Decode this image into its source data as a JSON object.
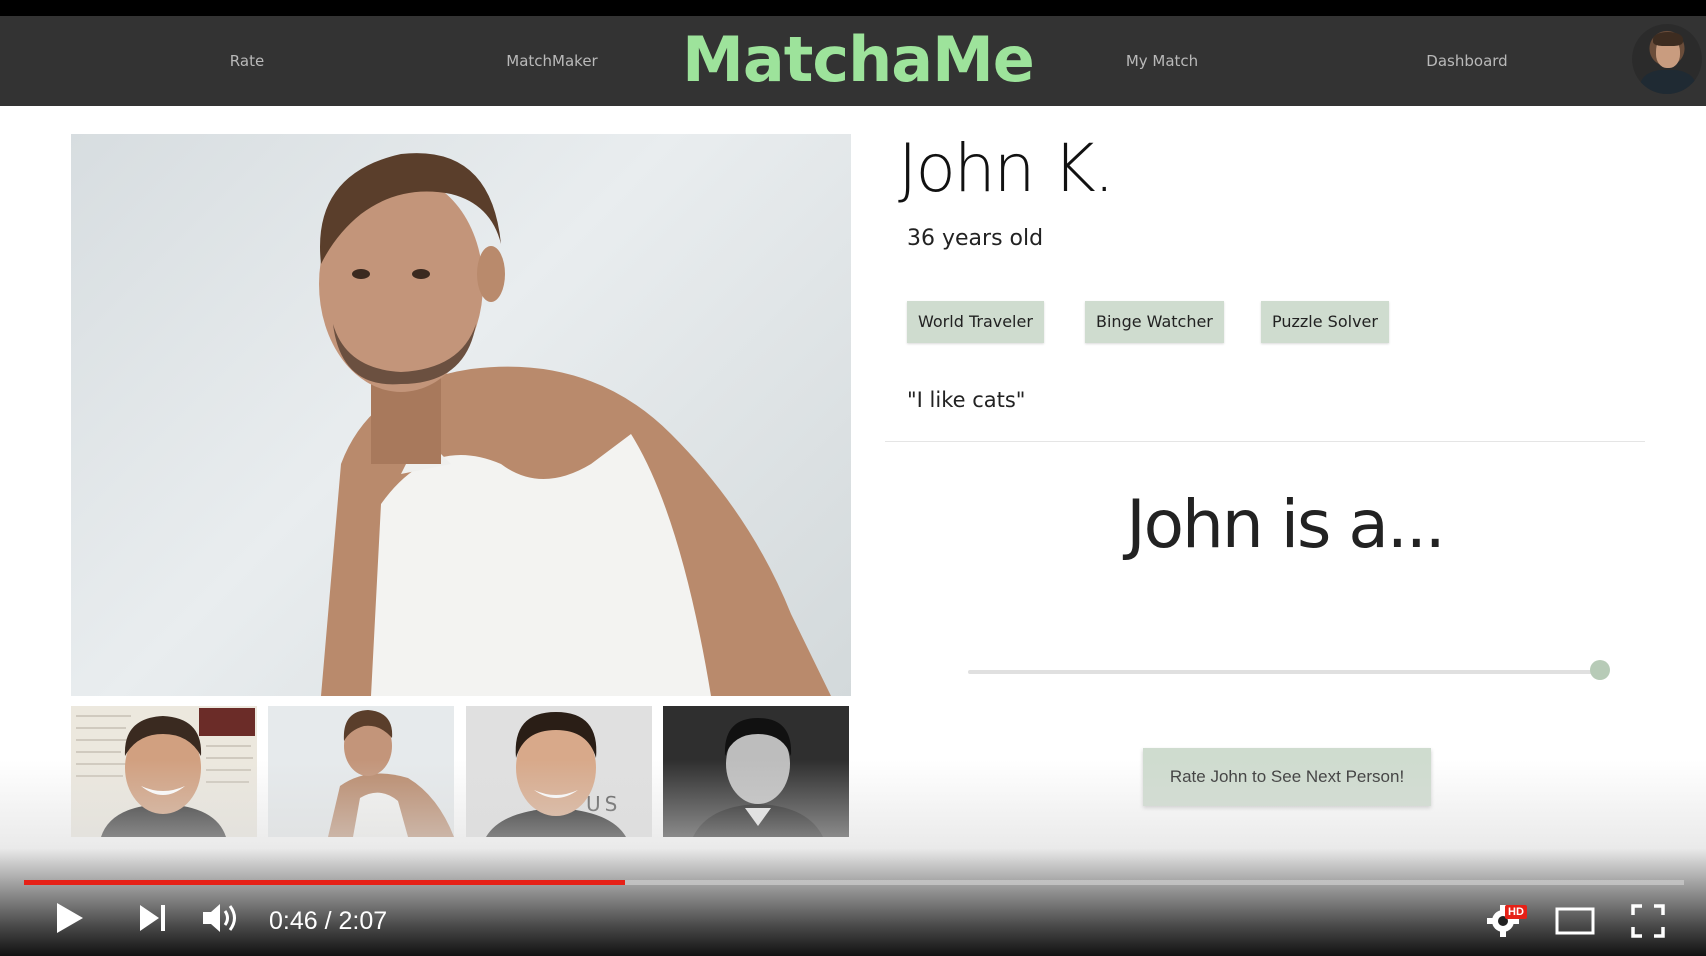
{
  "nav": {
    "links": [
      "Rate",
      "MatchMaker",
      "My Match",
      "Dashboard"
    ],
    "brand": "MatchaMe",
    "brand_color": "#9de39b",
    "bar_color": "#333333"
  },
  "profile": {
    "name": "John K.",
    "age": "36 years old",
    "tags": [
      "World Traveler",
      "Binge Watcher",
      "Puzzle Solver"
    ],
    "quote": "\"I like cats\""
  },
  "rating": {
    "heading": "John is a...",
    "slider_value_fraction": 1.0,
    "button_label": "Rate John to See Next Person!"
  },
  "video_player": {
    "current_time": "0:46",
    "duration": "2:07",
    "time_text": "0:46 / 2:07",
    "progress_fraction": 0.362,
    "hd_label": "HD",
    "accent_color": "#e62117"
  }
}
